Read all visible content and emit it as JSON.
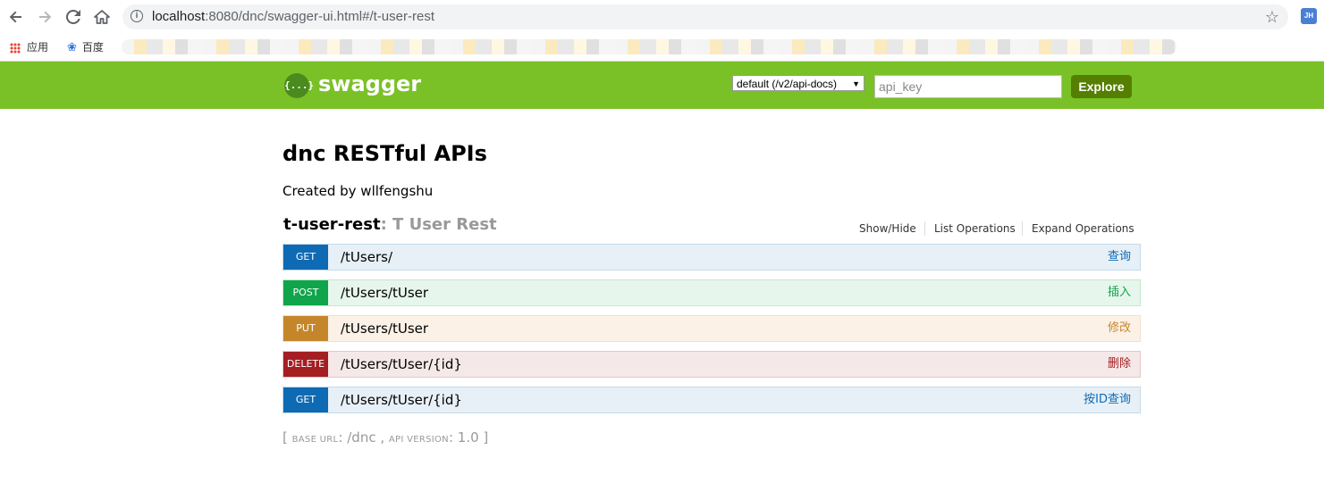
{
  "browser": {
    "url_host": "localhost",
    "url_rest": ":8080/dnc/swagger-ui.html#/t-user-rest",
    "profile_initials": "JH",
    "bookmarks": [
      {
        "label": "应用",
        "icon": "apps-grid-icon"
      },
      {
        "label": "百度",
        "icon": "baidu-paw-icon"
      }
    ]
  },
  "header": {
    "logo_glyph": "{...}",
    "logo_text": "swagger",
    "spec_select_value": "default (/v2/api-docs)",
    "api_key_placeholder": "api_key",
    "explore_label": "Explore",
    "brand_color": "#7ac127"
  },
  "main": {
    "title": "dnc RESTful APIs",
    "created_by": "Created by wllfengshu",
    "resource": {
      "name": "t-user-rest",
      "description": ": T User Rest",
      "links": [
        "Show/Hide",
        "List Operations",
        "Expand Operations"
      ]
    },
    "operations": [
      {
        "method": "GET",
        "path": "/tUsers/",
        "summary": "查询"
      },
      {
        "method": "POST",
        "path": "/tUsers/tUser",
        "summary": "插入"
      },
      {
        "method": "PUT",
        "path": "/tUsers/tUser",
        "summary": "修改"
      },
      {
        "method": "DELETE",
        "path": "/tUsers/tUser/{id}",
        "summary": "删除"
      },
      {
        "method": "GET",
        "path": "/tUsers/tUser/{id}",
        "summary": "按ID查询"
      }
    ],
    "footer": {
      "open": "[ ",
      "base_url_label": "BASE URL",
      "base_url_value": ": /dnc , ",
      "api_version_label": "API VERSION",
      "api_version_value": ": 1.0 ]"
    }
  }
}
